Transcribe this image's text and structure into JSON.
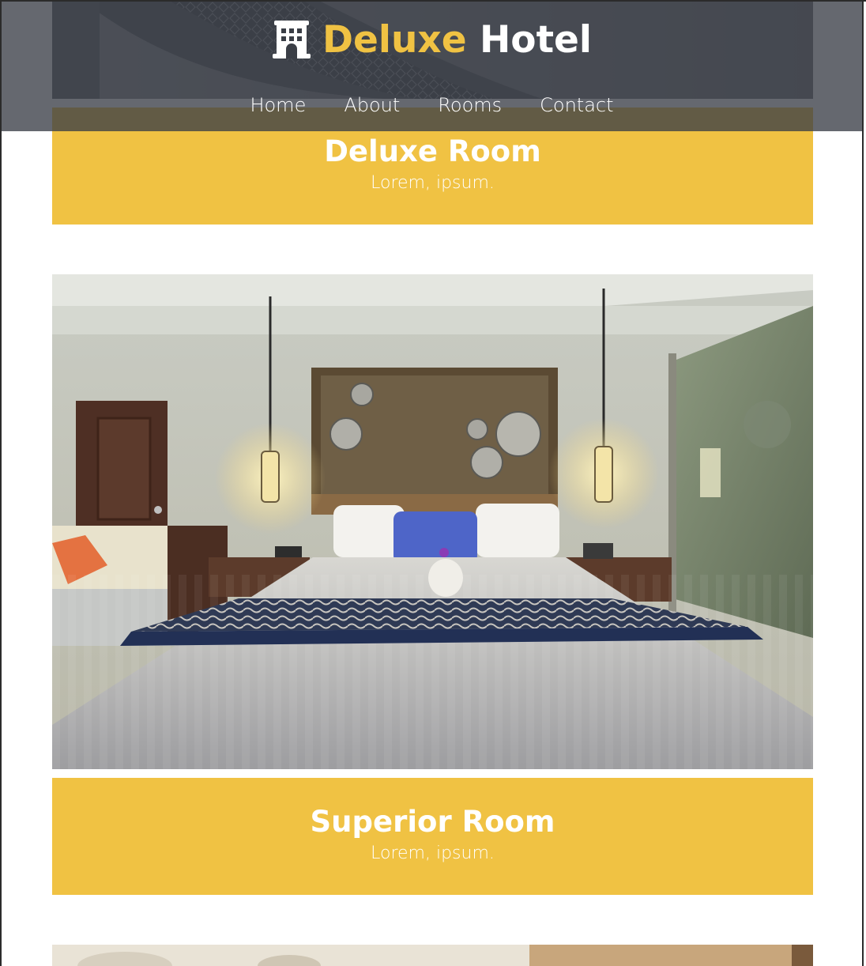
{
  "brand": {
    "icon": "building-icon",
    "name_accent": "Deluxe",
    "name_rest": "Hotel",
    "accent_color": "#f0c243"
  },
  "nav": {
    "items": [
      {
        "label": "Home"
      },
      {
        "label": "About"
      },
      {
        "label": "Rooms"
      },
      {
        "label": "Contact"
      }
    ]
  },
  "rooms": [
    {
      "title": "Deluxe Room",
      "subtitle": "Lorem, ipsum."
    },
    {
      "title": "Superior Room",
      "subtitle": "Lorem, ipsum."
    }
  ],
  "colors": {
    "banner": "#f0c243",
    "header_overlay": "#3a3e46"
  }
}
